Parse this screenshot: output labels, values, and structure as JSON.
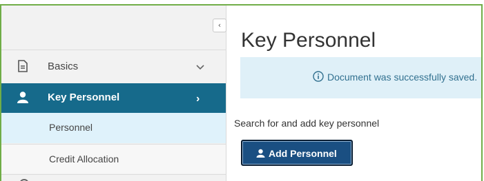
{
  "sidebar": {
    "collapse_glyph": "‹",
    "items": [
      {
        "label": "Basics",
        "icon": "document-icon",
        "expander": "chevron-down-icon"
      },
      {
        "label": "Key Personnel",
        "icon": "user-icon",
        "expander": "›",
        "active": true
      },
      {
        "label": "Personnel",
        "selected": true
      },
      {
        "label": "Credit Allocation"
      }
    ]
  },
  "main": {
    "title": "Key Personnel",
    "alert": {
      "message": "Document was successfully saved.",
      "icon": "info-icon"
    },
    "helper_text": "Search for and add key personnel",
    "add_button": {
      "label": "Add Personnel",
      "icon": "user-icon"
    }
  },
  "colors": {
    "active_nav_bg": "#166a8b",
    "selected_sub_bg": "#dff2fb",
    "alert_bg": "#dff0f8",
    "button_bg": "#1a4f82",
    "frame_border": "#70ad47"
  }
}
